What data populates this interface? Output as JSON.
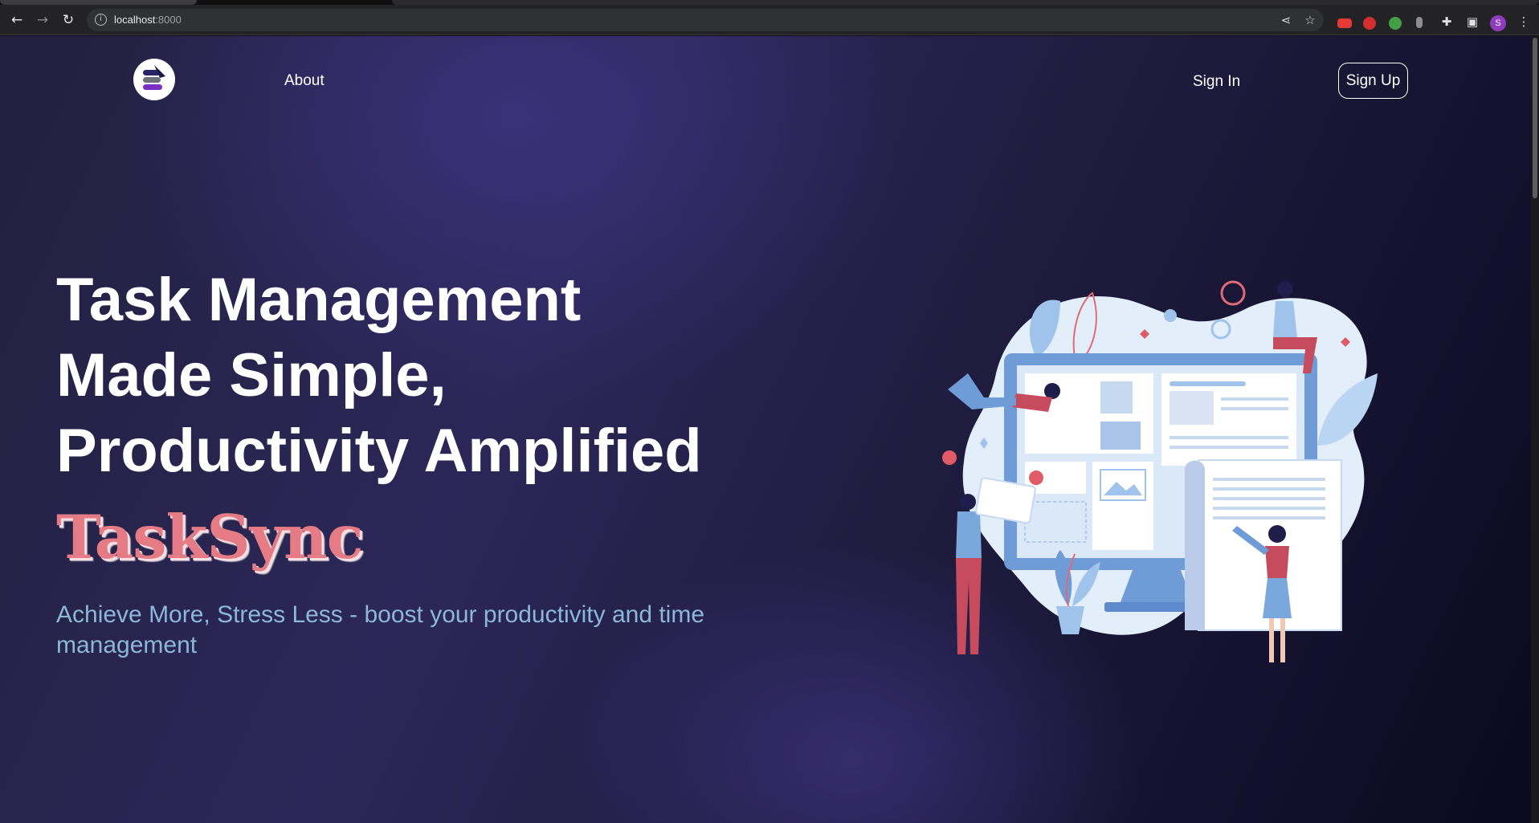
{
  "browser": {
    "url_host": "localhost",
    "url_port": ":8000",
    "profile_initial": "S",
    "extension_colors": [
      "#e53935",
      "#d32f2f",
      "#43a047",
      "#8d8d8d"
    ]
  },
  "nav": {
    "about": "About",
    "sign_in": "Sign In",
    "sign_up": "Sign Up"
  },
  "hero": {
    "title_lines": [
      "Task Management",
      "Made Simple,",
      "Productivity Amplified"
    ],
    "brand": "TaskSync",
    "tagline": "Achieve More, Stress Less - boost your productivity and time management"
  },
  "colors": {
    "brand": "#e47b85",
    "tagline": "#8ab8d6",
    "accent_blue": "#7aa7dc",
    "accent_red": "#e05a68"
  }
}
